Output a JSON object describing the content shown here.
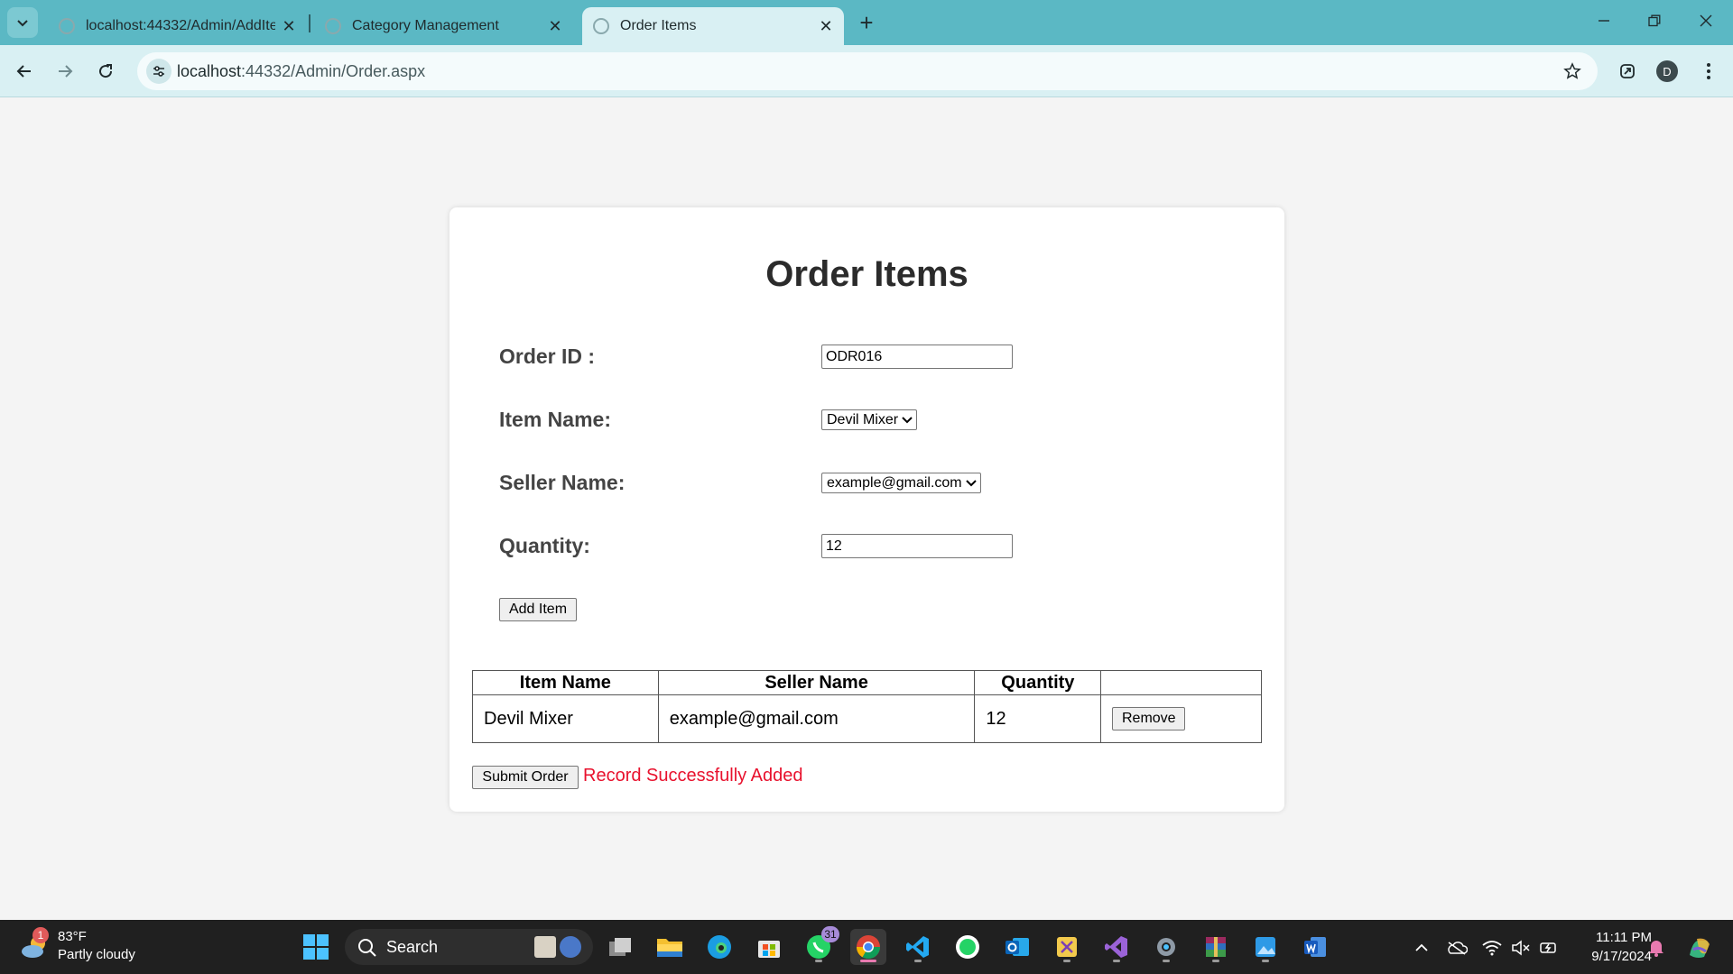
{
  "browser": {
    "tabs": [
      {
        "title": "localhost:44332/Admin/AddIten",
        "active": false
      },
      {
        "title": "Category Management",
        "active": false
      },
      {
        "title": "Order Items",
        "active": true
      }
    ],
    "url_host": "localhost",
    "url_rest": ":44332/Admin/Order.aspx",
    "profile_initial": "D"
  },
  "page": {
    "title": "Order Items",
    "form": {
      "order_id_label": "Order ID :",
      "order_id_value": "ODR016",
      "item_name_label": "Item Name:",
      "item_name_selected": "Devil Mixer",
      "seller_name_label": "Seller Name:",
      "seller_name_selected": "example@gmail.com",
      "quantity_label": "Quantity:",
      "quantity_value": "12",
      "add_item_button": "Add Item"
    },
    "table": {
      "headers": [
        "Item Name",
        "Seller Name",
        "Quantity",
        ""
      ],
      "rows": [
        {
          "item_name": "Devil Mixer",
          "seller_name": "example@gmail.com",
          "quantity": "12",
          "action": "Remove"
        }
      ]
    },
    "submit_button": "Submit Order",
    "status_message": "Record Successfully Added",
    "status_color": "#e8112d"
  },
  "taskbar": {
    "weather_temp": "83°F",
    "weather_desc": "Partly cloudy",
    "weather_badge": "1",
    "search_label": "Search",
    "whatsapp_badge": "31",
    "time": "11:11 PM",
    "date": "9/17/2024"
  }
}
